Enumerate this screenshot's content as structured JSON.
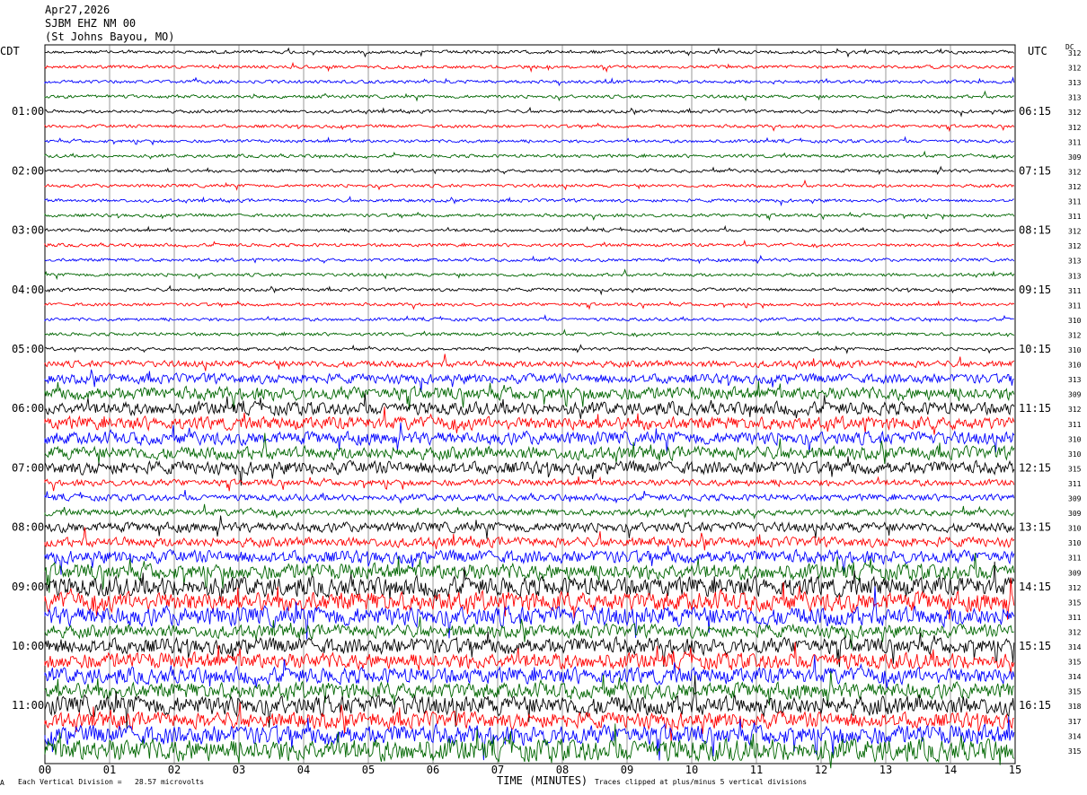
{
  "header": {
    "date": "Apr27,2026",
    "station": "SJBM EHZ NM 00",
    "location": "(St Johns Bayou, MO)"
  },
  "left_tz": "CDT",
  "right_tz": "UTC",
  "dc_header": "DC",
  "footer": {
    "division": "Each Vertical Division =   28.57 microvolts",
    "xlabel": "TIME (MINUTES)",
    "clip": "Traces clipped at plus/minus 5 vertical divisions",
    "corner_mark": "A"
  },
  "chart_data": {
    "type": "line",
    "title": "SJBM EHZ NM 00",
    "xlabel": "TIME (MINUTES)",
    "xlim": [
      0,
      15
    ],
    "x_ticks": [
      "00",
      "01",
      "02",
      "03",
      "04",
      "05",
      "06",
      "07",
      "08",
      "09",
      "10",
      "11",
      "12",
      "13",
      "14",
      "15"
    ],
    "trace_colors": [
      "#000000",
      "#ff0000",
      "#0000ff",
      "#006600"
    ],
    "left_hour_labels": [
      {
        "row": 4,
        "text": "01:00"
      },
      {
        "row": 8,
        "text": "02:00"
      },
      {
        "row": 12,
        "text": "03:00"
      },
      {
        "row": 16,
        "text": "04:00"
      },
      {
        "row": 20,
        "text": "05:00"
      },
      {
        "row": 24,
        "text": "06:00"
      },
      {
        "row": 28,
        "text": "07:00"
      },
      {
        "row": 32,
        "text": "08:00"
      },
      {
        "row": 36,
        "text": "09:00"
      },
      {
        "row": 40,
        "text": "10:00"
      },
      {
        "row": 44,
        "text": "11:00"
      }
    ],
    "right_hour_labels": [
      {
        "row": 4,
        "text": "06:15"
      },
      {
        "row": 8,
        "text": "07:15"
      },
      {
        "row": 12,
        "text": "08:15"
      },
      {
        "row": 16,
        "text": "09:15"
      },
      {
        "row": 20,
        "text": "10:15"
      },
      {
        "row": 24,
        "text": "11:15"
      },
      {
        "row": 28,
        "text": "12:15"
      },
      {
        "row": 32,
        "text": "13:15"
      },
      {
        "row": 36,
        "text": "14:15"
      },
      {
        "row": 40,
        "text": "15:15"
      },
      {
        "row": 44,
        "text": "16:15"
      }
    ],
    "dc_values": [
      312,
      312,
      313,
      313,
      312,
      312,
      311,
      309,
      312,
      312,
      311,
      311,
      312,
      312,
      313,
      313,
      311,
      311,
      310,
      312,
      310,
      310,
      313,
      309,
      312,
      311,
      310,
      310,
      315,
      311,
      309,
      309,
      310,
      310,
      311,
      309,
      312,
      315,
      311,
      312,
      314,
      315,
      314,
      315,
      318,
      317,
      314,
      315
    ],
    "trace_amplitude": [
      1,
      1,
      1,
      1,
      1,
      1,
      1,
      1,
      1,
      1,
      1,
      1,
      1,
      1,
      1,
      1,
      1,
      1,
      1,
      1,
      1,
      2,
      3,
      4,
      4,
      4,
      4,
      4,
      4,
      2,
      2,
      2,
      3,
      3,
      4,
      5,
      6,
      6,
      6,
      4,
      5,
      5,
      5,
      5,
      6,
      5,
      6,
      7
    ]
  }
}
